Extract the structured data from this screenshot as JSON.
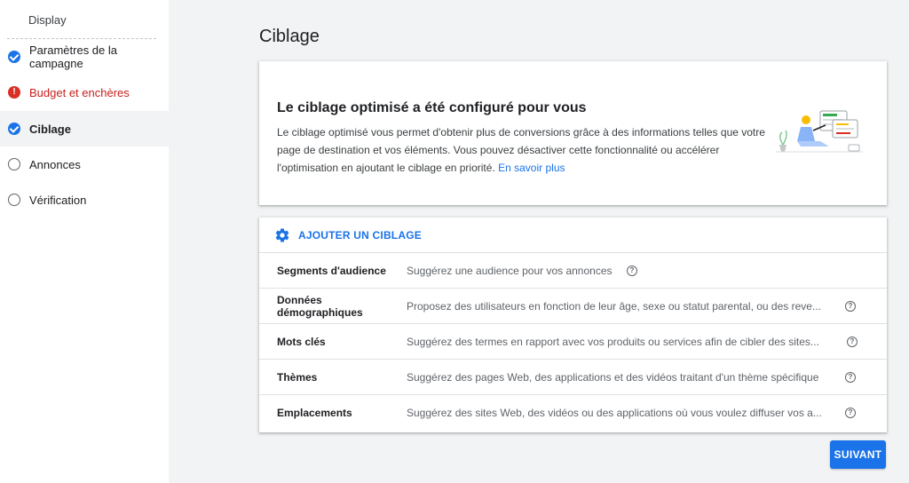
{
  "sidebar": {
    "display_label": "Display",
    "items": [
      {
        "label": "Paramètres de la campagne",
        "status": "done"
      },
      {
        "label": "Budget et enchères",
        "status": "error"
      },
      {
        "label": "Ciblage",
        "status": "done"
      },
      {
        "label": "Annonces",
        "status": "empty"
      },
      {
        "label": "Vérification",
        "status": "empty"
      }
    ],
    "error_glyph": "!"
  },
  "page": {
    "title": "Ciblage"
  },
  "info_card": {
    "heading": "Le ciblage optimisé a été configuré pour vous",
    "body": "Le ciblage optimisé vous permet d'obtenir plus de conversions grâce à des informations telles que votre page de destination et vos éléments. Vous pouvez désactiver cette fonctionnalité ou accélérer l'optimisation en ajoutant le ciblage en priorité.",
    "link": "En savoir plus"
  },
  "targeting": {
    "add_label": "AJOUTER UN CIBLAGE",
    "rows": [
      {
        "name": "Segments d'audience",
        "description": "Suggérez une audience pour vos annonces"
      },
      {
        "name": "Données démographiques",
        "description": "Proposez des utilisateurs en fonction de leur âge, sexe ou statut parental, ou des reve..."
      },
      {
        "name": "Mots clés",
        "description": "Suggérez des termes en rapport avec vos produits ou services afin de cibler des sites..."
      },
      {
        "name": "Thèmes",
        "description": "Suggérez des pages Web, des applications et des vidéos traitant d'un thème spécifique"
      },
      {
        "name": "Emplacements",
        "description": "Suggérez des sites Web, des vidéos ou des applications où vous voulez diffuser vos a..."
      }
    ],
    "help_glyph": "?"
  },
  "footer": {
    "next_label": "SUIVANT"
  },
  "colors": {
    "accent": "#1a73e8",
    "error": "#d93025",
    "background": "#f1f3f4"
  },
  "icons": [
    "check-circle-icon",
    "error-circle-icon",
    "empty-circle-icon",
    "gear-icon",
    "help-icon",
    "illustration"
  ]
}
